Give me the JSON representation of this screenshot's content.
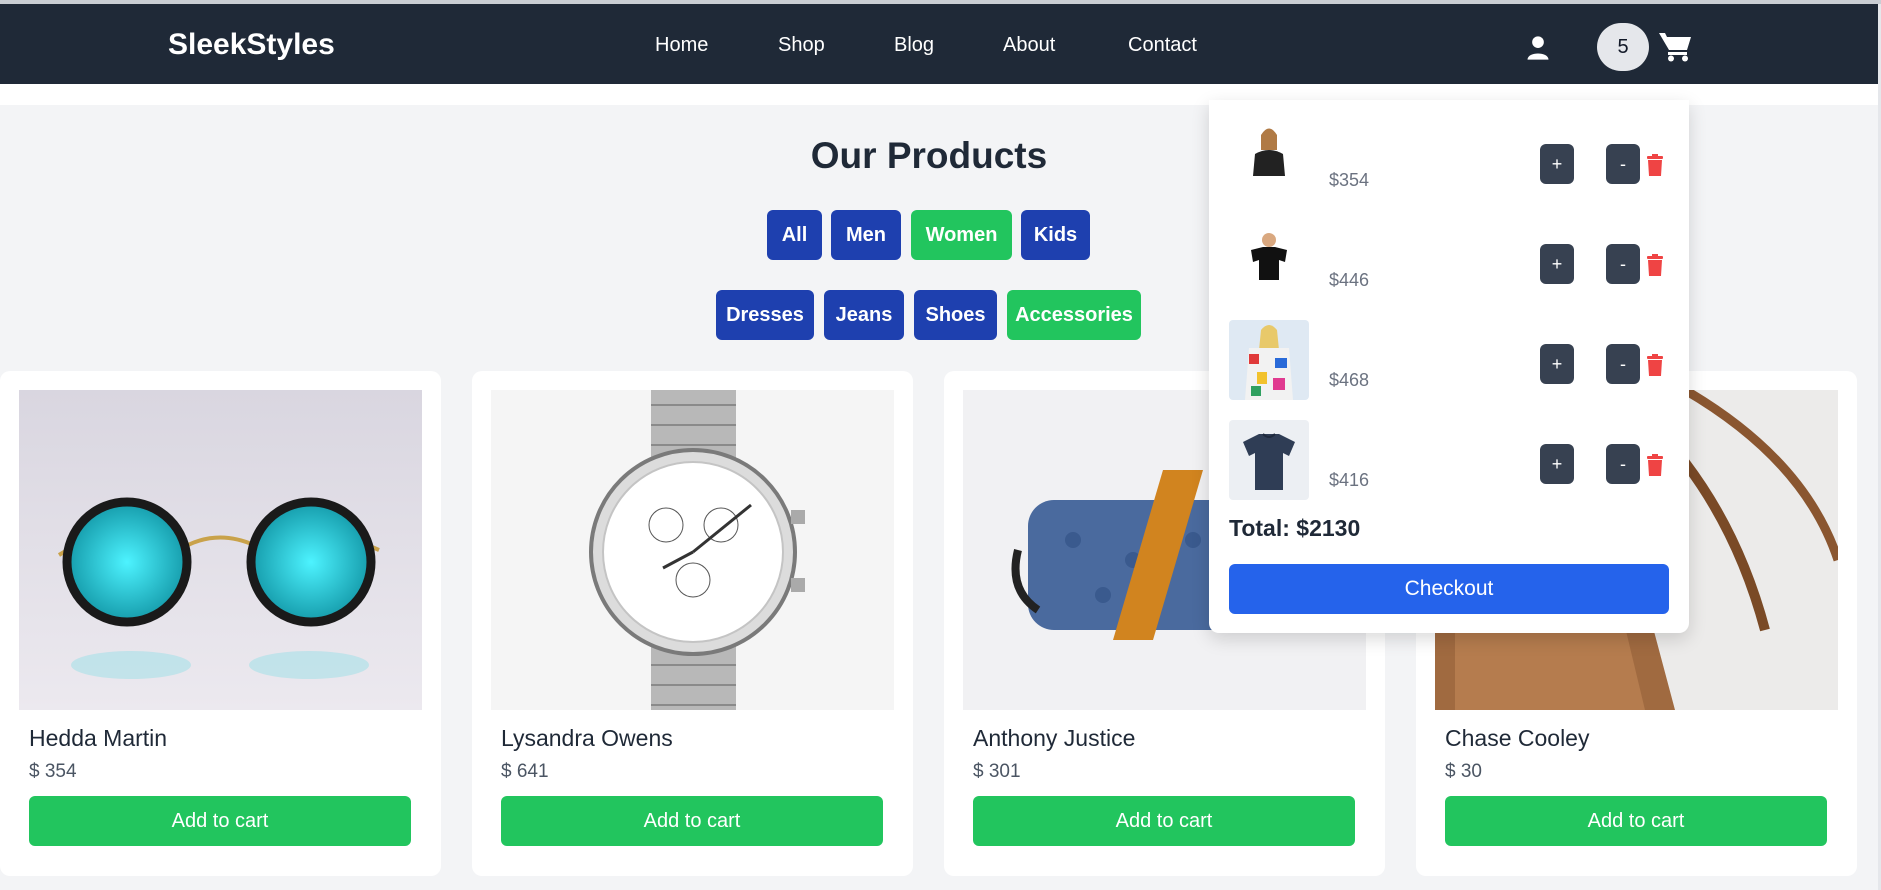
{
  "brand": "SleekStyles",
  "nav": {
    "links": [
      "Home",
      "Shop",
      "Blog",
      "About",
      "Contact"
    ]
  },
  "header": {
    "cart_qty": "5",
    "user_icon": "user-icon",
    "cart_icon": "shopping-cart-icon"
  },
  "page_title": "Our Products",
  "filters": {
    "row1": [
      "All",
      "Men",
      "Women",
      "Kids"
    ],
    "row2": [
      "Dresses",
      "Jeans",
      "Shoes",
      "Accessories"
    ],
    "active": [
      "Women",
      "Accessories"
    ]
  },
  "products": [
    {
      "name": "Hedda Martin",
      "price": "$ 354",
      "button": "Add to cart",
      "image": "round-sunglasses"
    },
    {
      "name": "Lysandra Owens",
      "price": "$ 641",
      "button": "Add to cart",
      "image": "chronograph-watch"
    },
    {
      "name": "Anthony Justice",
      "price": "$ 301",
      "button": "Add to cart",
      "image": "crossbody-bag"
    },
    {
      "name": "Chase Cooley",
      "price": "$ 30",
      "button": "Add to cart",
      "image": "leather-bag"
    }
  ],
  "cart": {
    "items": [
      {
        "price": "$354",
        "image": "woman-model"
      },
      {
        "price": "$446",
        "image": "black-tshirt"
      },
      {
        "price": "$468",
        "image": "printed-jacket"
      },
      {
        "price": "$416",
        "image": "navy-tshirt"
      }
    ],
    "plus_label": "+",
    "minus_label": "-",
    "total": "Total: $2130",
    "checkout": "Checkout"
  },
  "colors": {
    "navbar": "#1f2937",
    "filter_default": "#1e40af",
    "filter_active": "#22c55e",
    "add_to_cart": "#22c55e",
    "checkout": "#2563eb",
    "trash": "#ef4444"
  }
}
